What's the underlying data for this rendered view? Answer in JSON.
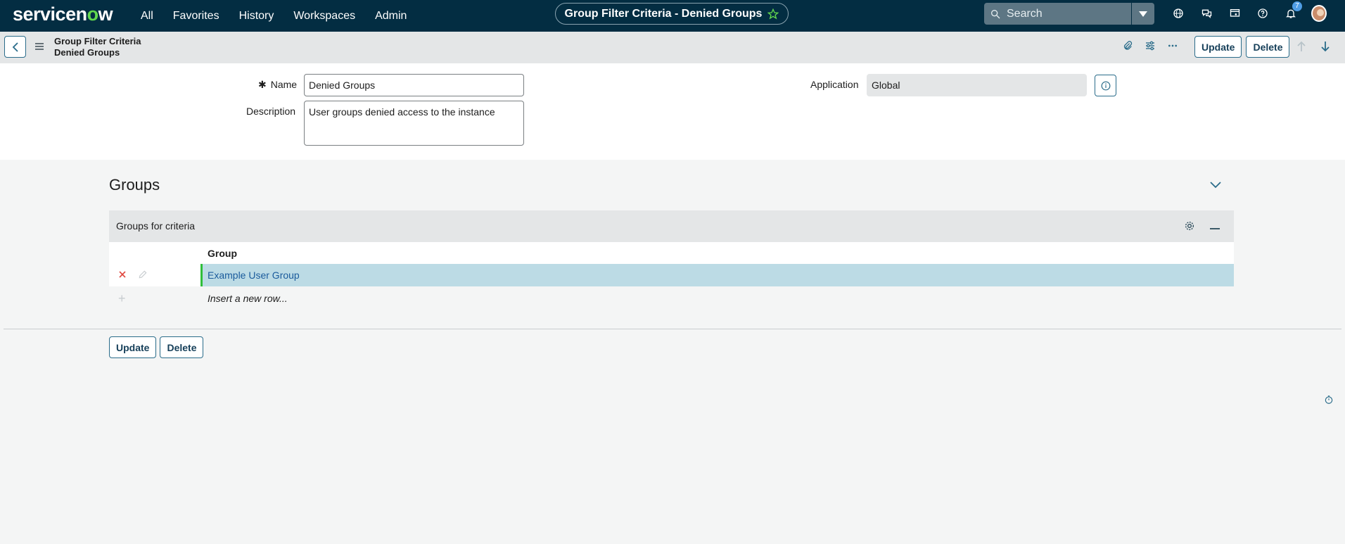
{
  "nav": {
    "logo_prefix": "servicen",
    "logo_o": "o",
    "logo_suffix": "w",
    "items": [
      "All",
      "Favorites",
      "History",
      "Workspaces",
      "Admin"
    ],
    "title": "Group Filter Criteria - Denied Groups",
    "search_placeholder": "Search",
    "notification_count": "7",
    "icons": [
      "globe-icon",
      "chat-icon",
      "screen-share-icon",
      "help-icon",
      "bell-icon"
    ]
  },
  "subheader": {
    "crumb_line1": "Group Filter Criteria",
    "crumb_line2": "Denied Groups",
    "update_label": "Update",
    "delete_label": "Delete"
  },
  "form": {
    "name_label": "Name",
    "name_value": "Denied Groups",
    "description_label": "Description",
    "description_value": "User groups denied access to the instance",
    "application_label": "Application",
    "application_value": "Global"
  },
  "related": {
    "section_title": "Groups",
    "list_title": "Groups for criteria",
    "column": "Group",
    "rows": [
      {
        "group": "Example User Group"
      }
    ],
    "insert_text": "Insert a new row..."
  },
  "bottom": {
    "update_label": "Update",
    "delete_label": "Delete"
  },
  "colors": {
    "nav_bg": "#032d42",
    "accent": "#62d84e",
    "row_highlight": "#bcdbe5",
    "link": "#1a5b9c"
  }
}
